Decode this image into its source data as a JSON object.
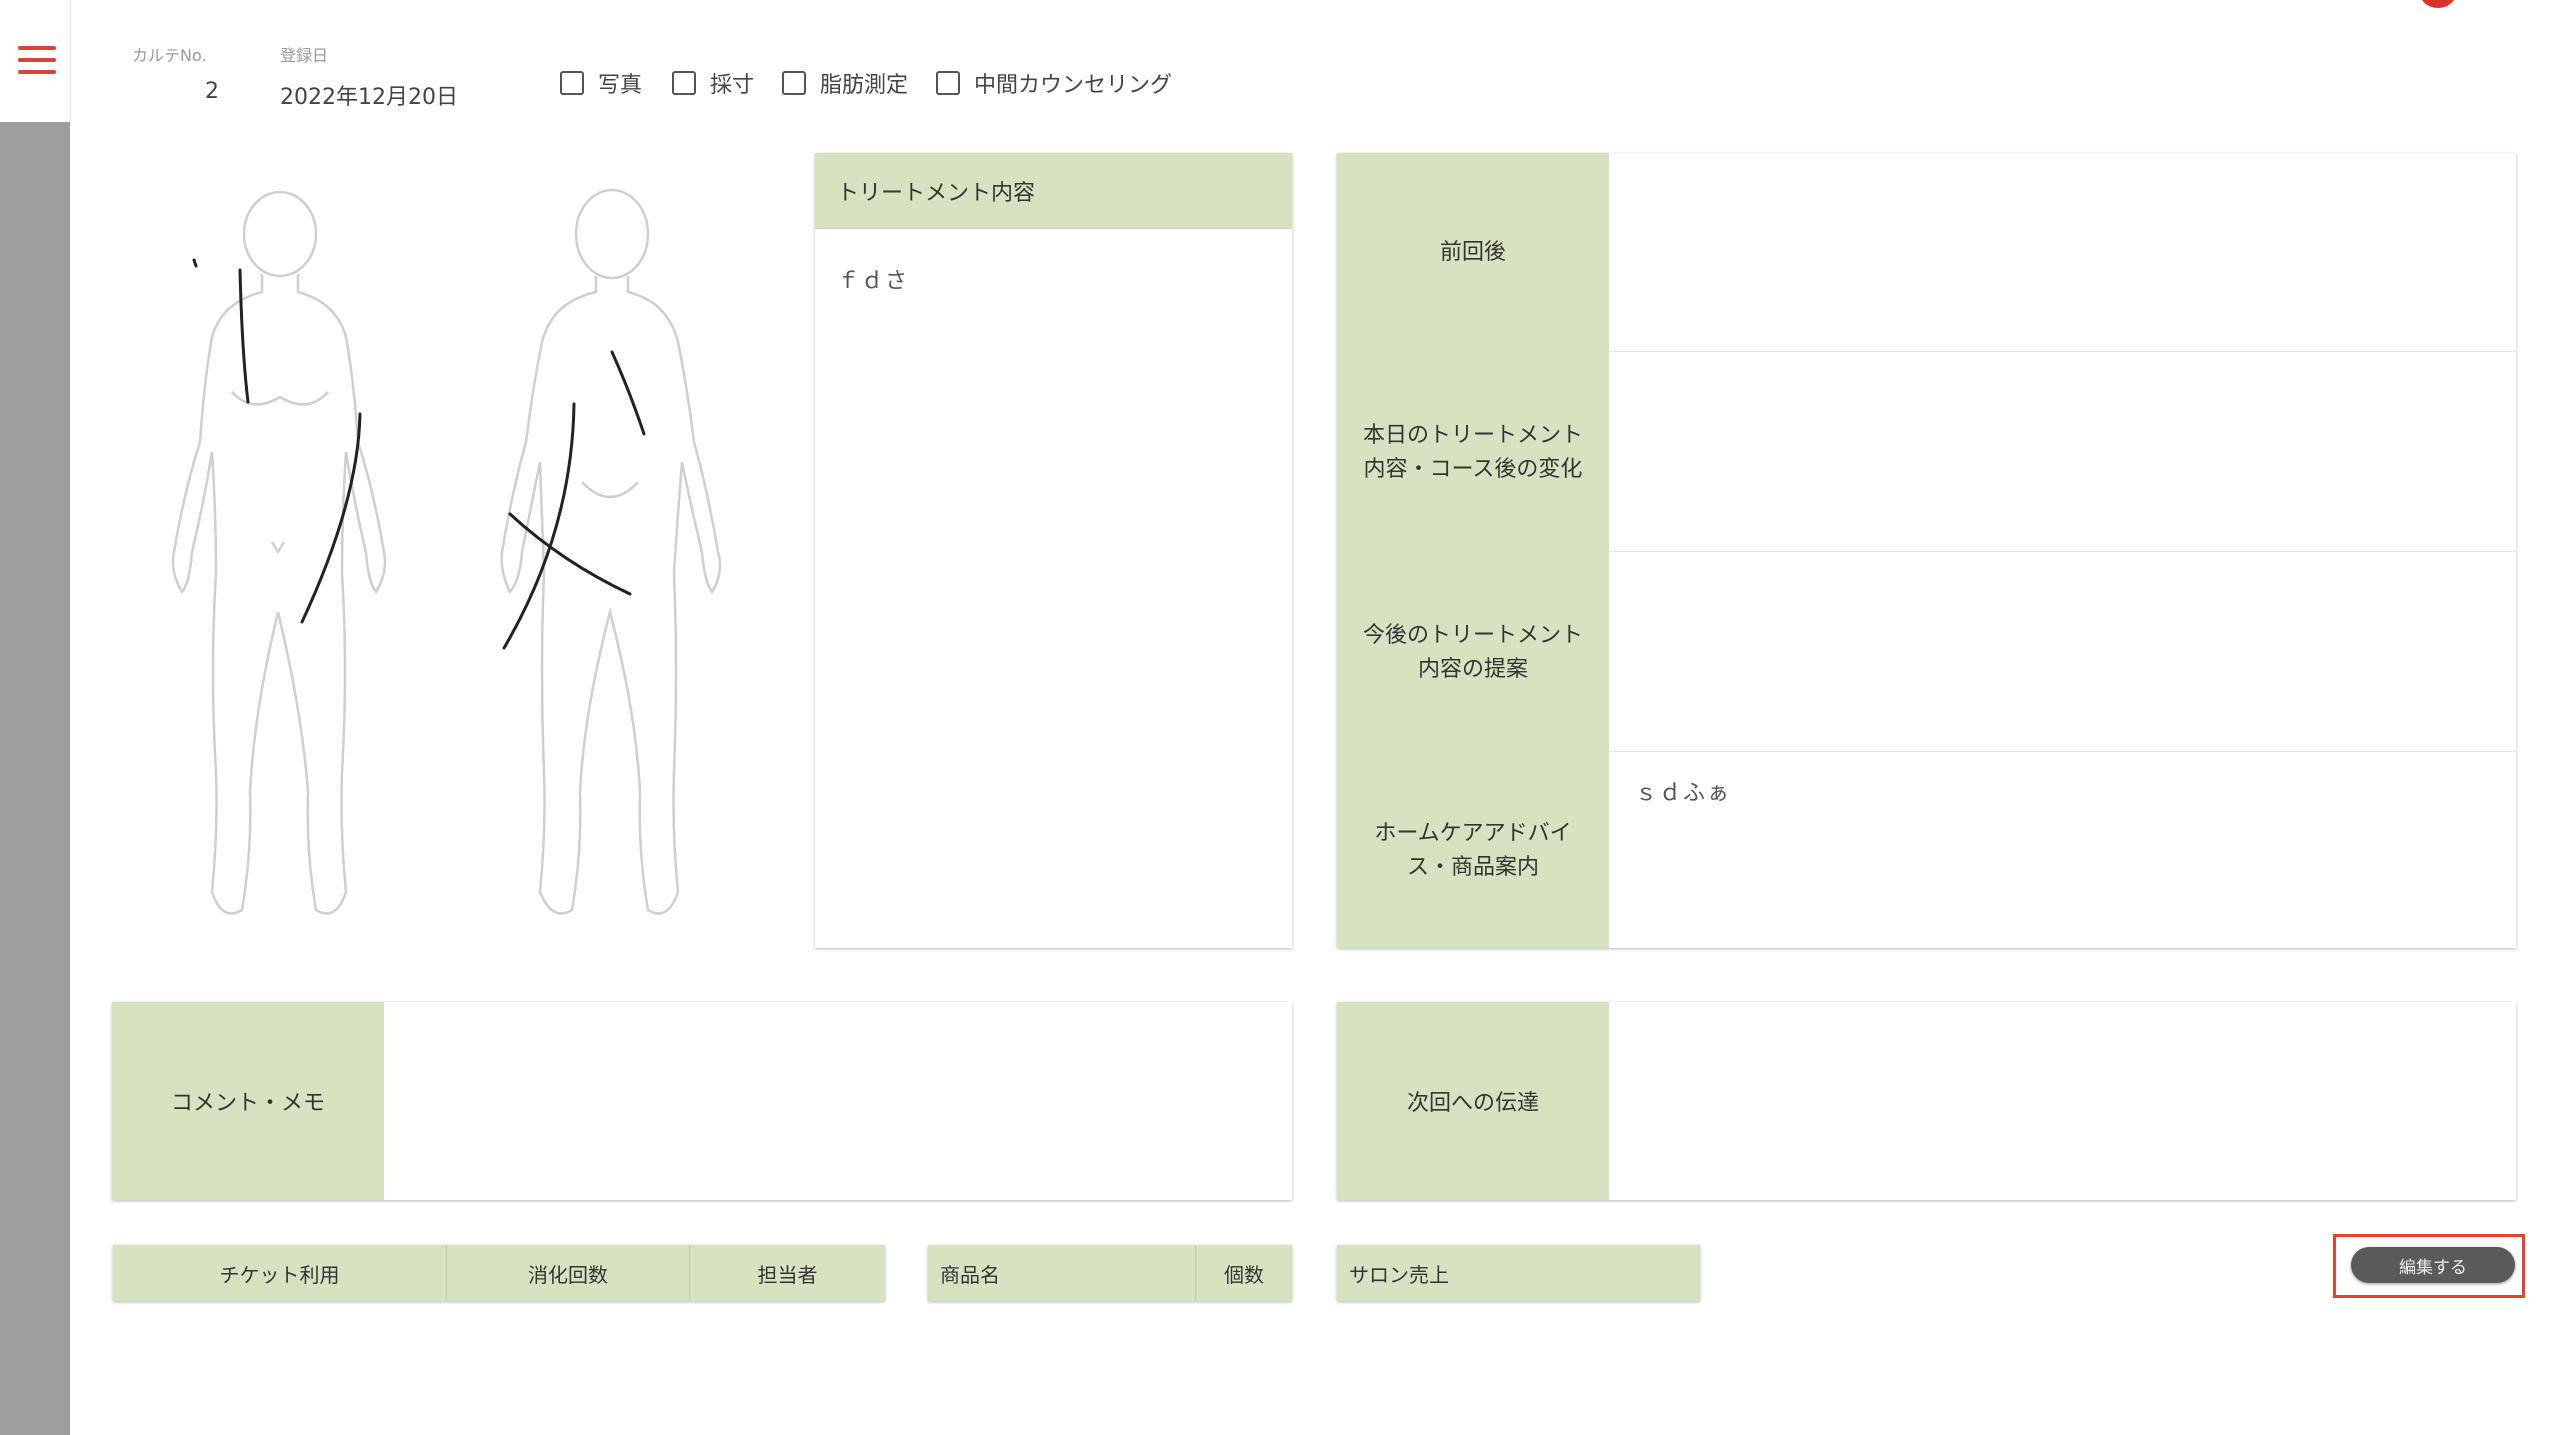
{
  "header": {
    "karte_no_label": "カルテNo.",
    "karte_no_value": "2",
    "reg_date_label": "登録日",
    "reg_date_value": "2022年12月20日",
    "checkboxes": [
      {
        "label": "写真",
        "checked": false
      },
      {
        "label": "採寸",
        "checked": false
      },
      {
        "label": "脂肪測定",
        "checked": false
      },
      {
        "label": "中間カウンセリング",
        "checked": false
      }
    ]
  },
  "treatment": {
    "header": "トリートメント内容",
    "content": "ｆｄさ"
  },
  "notes": [
    {
      "label_line1": "前回後",
      "label_line2": "",
      "value": ""
    },
    {
      "label_line1": "本日のトリートメント",
      "label_line2": "内容・コース後の変化",
      "value": ""
    },
    {
      "label_line1": "今後のトリートメント",
      "label_line2": "内容の提案",
      "value": ""
    },
    {
      "label_line1": "ホームケアアドバイ",
      "label_line2": "ス・商品案内",
      "value": "ｓｄふぁ"
    }
  ],
  "comment": {
    "label": "コメント・メモ",
    "value": ""
  },
  "next": {
    "label": "次回への伝達",
    "value": ""
  },
  "ticket_table": {
    "headers": [
      "チケット利用",
      "消化回数",
      "担当者"
    ]
  },
  "product_table": {
    "headers": [
      "商品名",
      "個数"
    ]
  },
  "salon_table": {
    "headers": [
      "サロン売上"
    ]
  },
  "edit_button": {
    "label": "編集する"
  },
  "colors": {
    "accent_green": "#d7e3c0",
    "menu_red": "#d9443a",
    "highlight_red": "#e8412f"
  }
}
